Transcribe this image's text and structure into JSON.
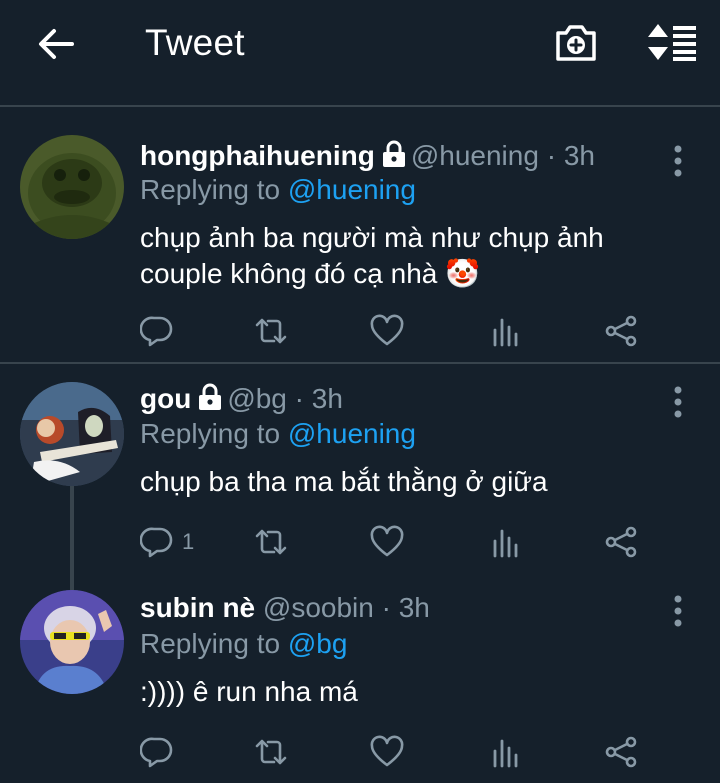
{
  "header": {
    "title": "Tweet",
    "back_icon": "arrow-left-icon",
    "camera_icon": "camera-add-icon",
    "sort_icon": "sort-icon"
  },
  "tweets": [
    {
      "name": "hongphaihuening",
      "handle": "@huening",
      "dot": "·",
      "time": "3h",
      "replying_prefix": "Replying to",
      "replying_to": "@huening",
      "text_line1": "chụp ảnh ba người mà như chụp ảnh",
      "text_line2": "couple không đó cạ nhà 🤡",
      "reply_count": ""
    },
    {
      "name": "gou",
      "handle": "@bg",
      "dot": "·",
      "time": "3h",
      "replying_prefix": "Replying to",
      "replying_to": "@huening",
      "text_line1": "chụp ba tha ma bắt thằng ở giữa",
      "reply_count": "1"
    },
    {
      "name": "subin nè",
      "handle": "@soobin",
      "dot": "·",
      "time": "3h",
      "replying_prefix": "Replying to",
      "replying_to": "@bg",
      "text_line1": ":)))) ê run nha má",
      "reply_count": ""
    }
  ],
  "colors": {
    "background": "#15202b",
    "secondary_text": "#8899a6",
    "accent": "#1da1f2",
    "divider": "#38444d"
  }
}
